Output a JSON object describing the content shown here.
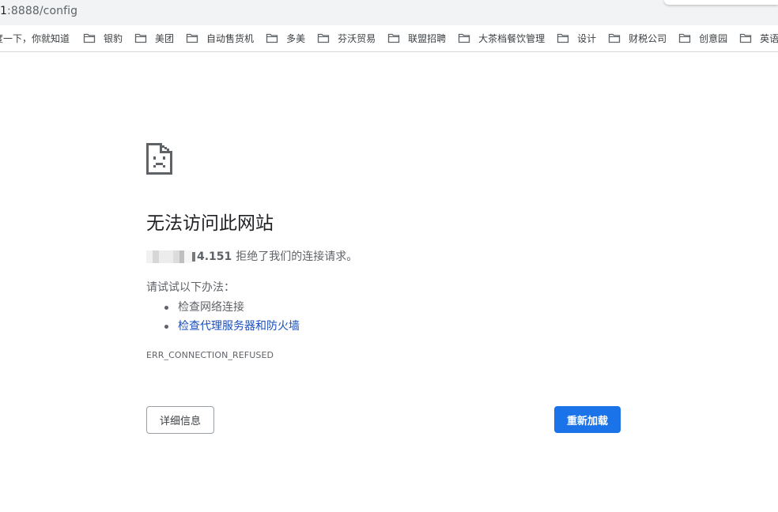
{
  "address_bar": {
    "url_host_fragment": "1",
    "url_rest": ":8888/config"
  },
  "bookmarks": [
    {
      "label": "度一下，你就知道",
      "icon": "none"
    },
    {
      "label": "银豹",
      "icon": "folder-icon"
    },
    {
      "label": "美团",
      "icon": "folder-icon"
    },
    {
      "label": "自动售货机",
      "icon": "folder-icon"
    },
    {
      "label": "多美",
      "icon": "folder-icon"
    },
    {
      "label": "芬沃贸易",
      "icon": "folder-icon"
    },
    {
      "label": "联盟招聘",
      "icon": "folder-icon"
    },
    {
      "label": "大茶档餐饮管理",
      "icon": "folder-icon"
    },
    {
      "label": "设计",
      "icon": "folder-icon"
    },
    {
      "label": "财税公司",
      "icon": "folder-icon"
    },
    {
      "label": "创意园",
      "icon": "folder-icon"
    },
    {
      "label": "英语",
      "icon": "folder-icon"
    }
  ],
  "error": {
    "icon": "sad-document-icon",
    "title": "无法访问此网站",
    "host_visible": "4.151",
    "message_suffix": "拒绝了我们的连接请求。",
    "suggest_heading": "请试试以下办法：",
    "suggestions": [
      {
        "text": "检查网络连接",
        "is_link": false
      },
      {
        "text": "检查代理服务器和防火墙",
        "is_link": true
      }
    ],
    "code": "ERR_CONNECTION_REFUSED"
  },
  "buttons": {
    "details": "详细信息",
    "reload": "重新加载"
  },
  "colors": {
    "primary_button": "#1a73e8",
    "link": "#1a4fbd",
    "body_text": "#5f6368",
    "title_text": "#202124"
  }
}
